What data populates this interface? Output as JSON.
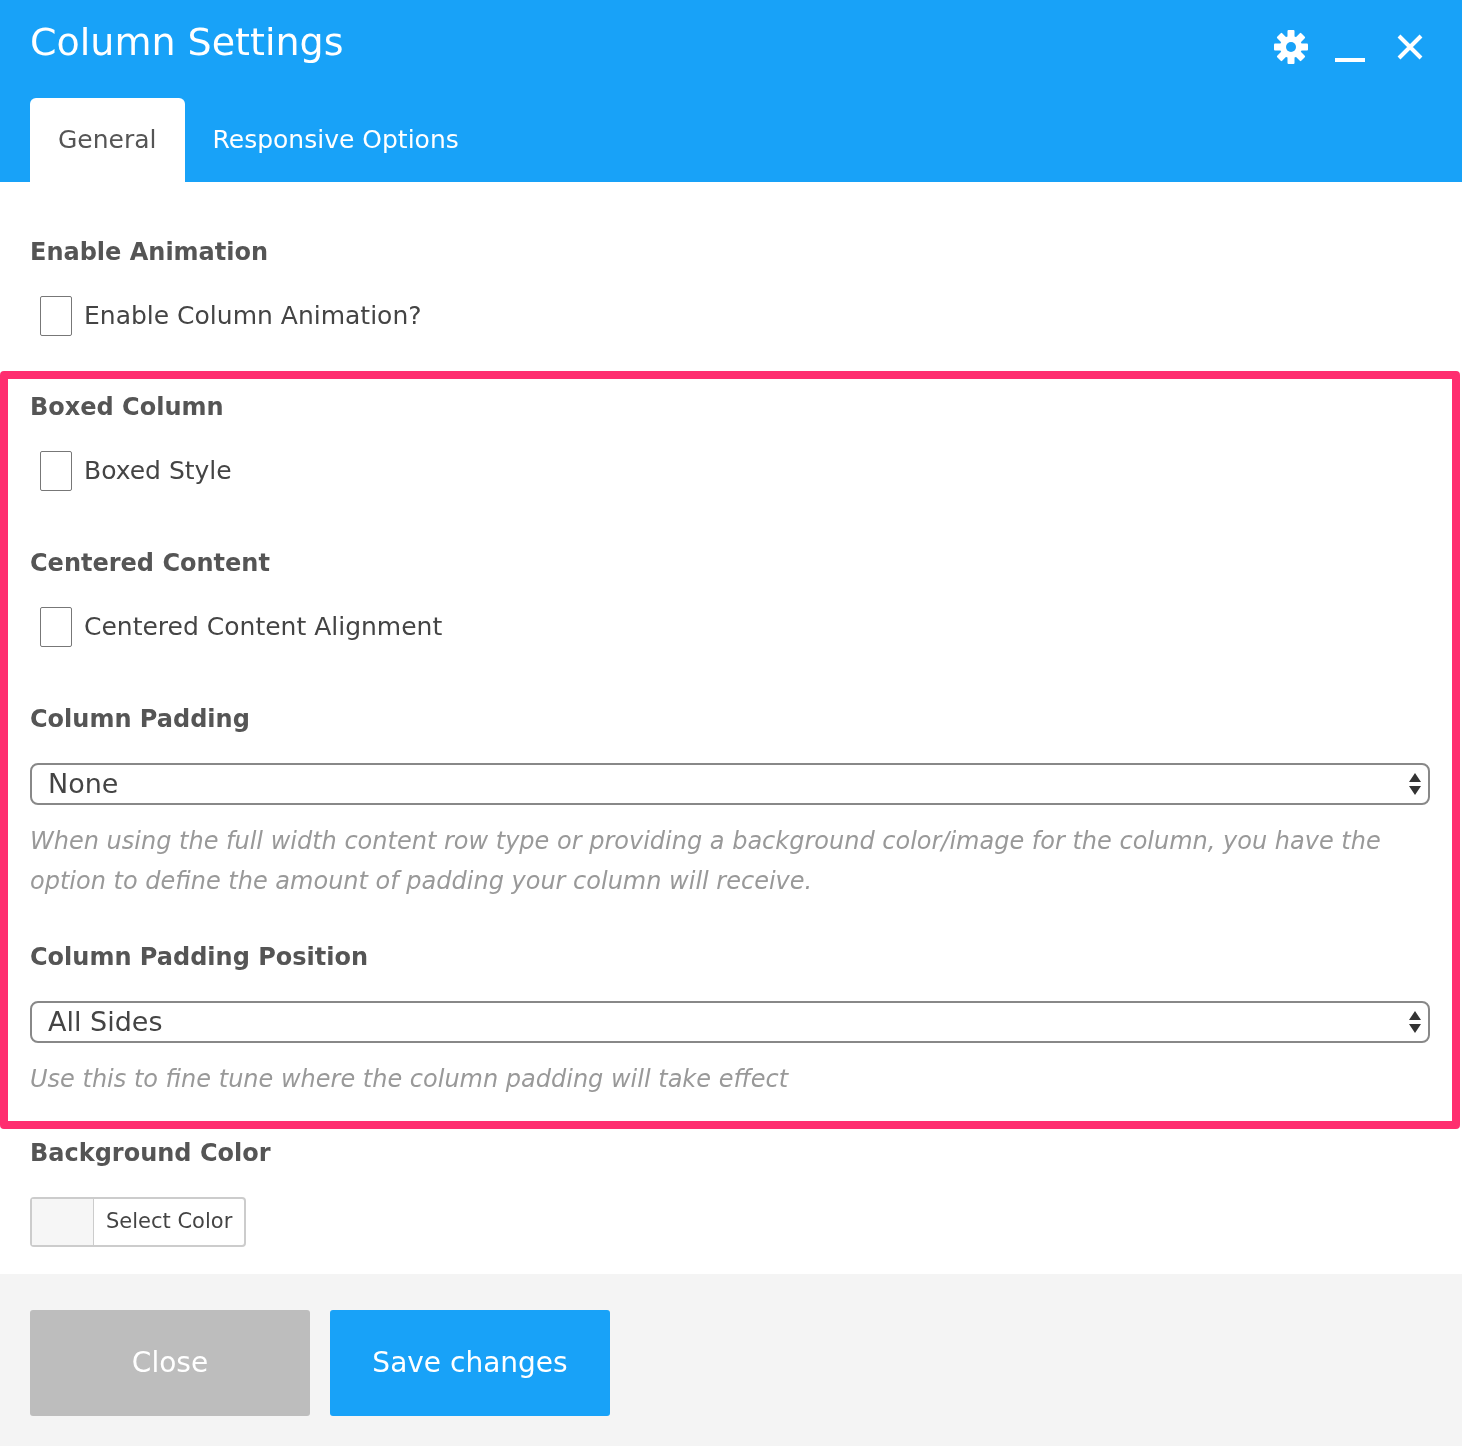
{
  "window": {
    "title": "Column Settings"
  },
  "tabs": [
    {
      "label": "General",
      "selected": true
    },
    {
      "label": "Responsive Options",
      "selected": false
    }
  ],
  "sections": [
    {
      "kind": "checkbox",
      "heading": "Enable Animation",
      "label": "Enable Column Animation?",
      "checked": false
    }
  ],
  "highlight_frame": {
    "sections": [
      {
        "kind": "checkbox",
        "heading": "Boxed Column",
        "label": "Boxed Style",
        "checked": false
      },
      {
        "kind": "checkbox",
        "heading": "Centered Content",
        "label": "Centered Content Alignment",
        "checked": false
      },
      {
        "kind": "select",
        "heading": "Column Padding",
        "value": "None",
        "help": "When using the full width content row type or providing a background color/image for the column, you have the option to define the amount of padding your column will receive."
      },
      {
        "kind": "select",
        "heading": "Column Padding Position",
        "value": "All Sides",
        "help": "Use this to fine tune where the column padding will take effect"
      }
    ]
  },
  "sections_after": [
    {
      "kind": "color",
      "heading": "Background Color",
      "button": "Select Color"
    }
  ],
  "buttons": [
    {
      "kind": "secondary",
      "label": "Close"
    },
    {
      "kind": "primary",
      "label": "Save changes"
    }
  ]
}
